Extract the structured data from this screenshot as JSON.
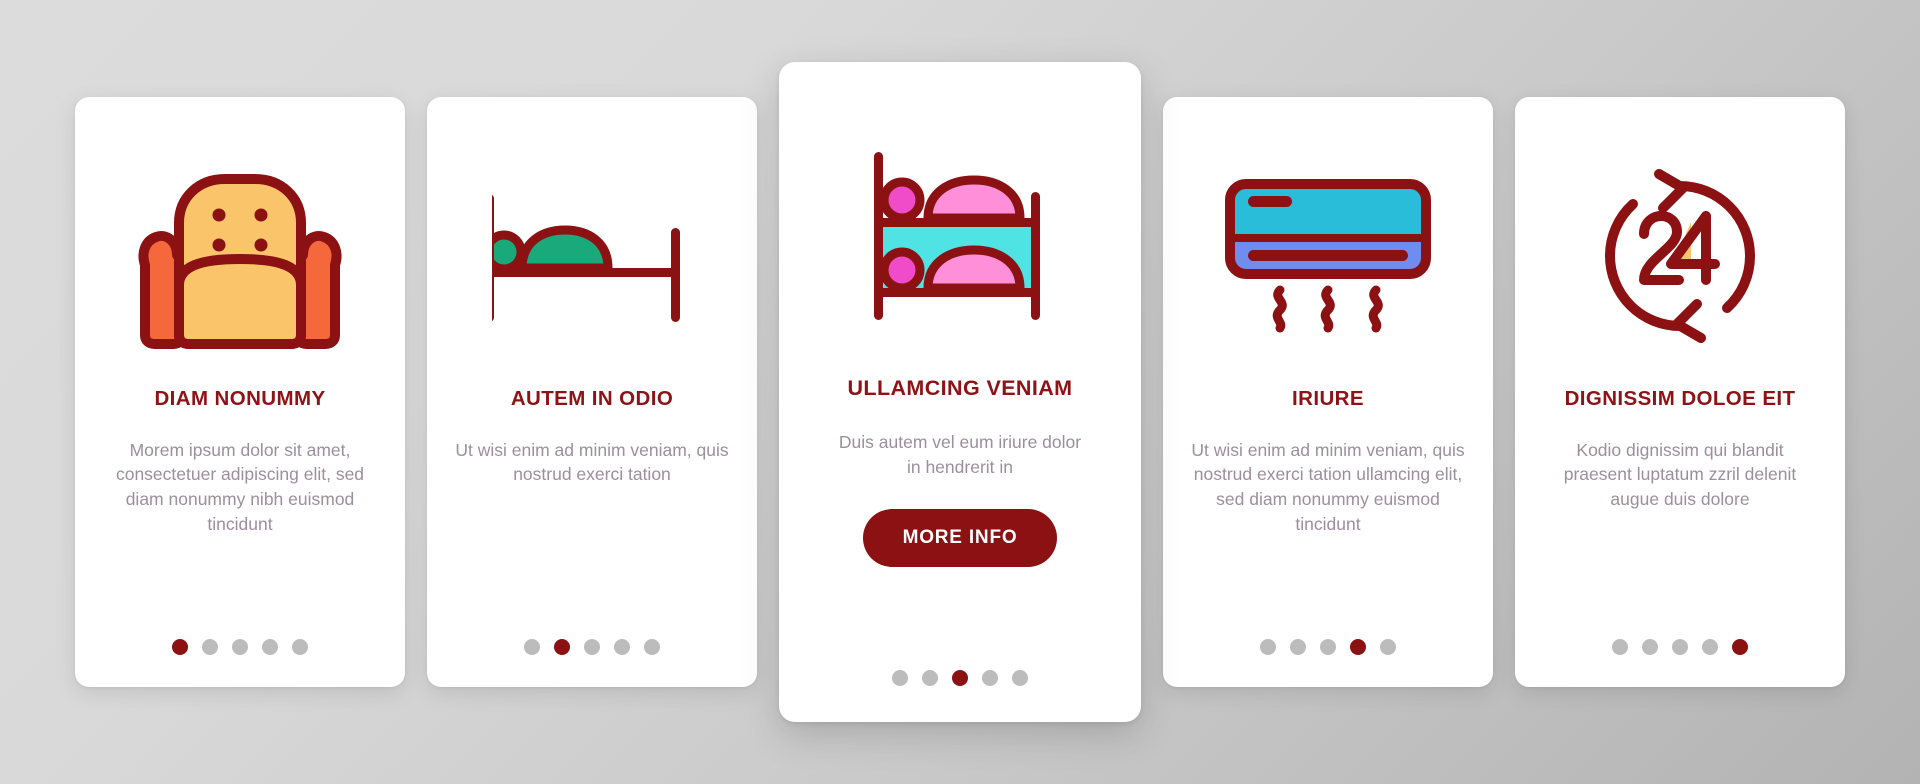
{
  "background": {
    "gradient_from": "#dcdcdc",
    "gradient_to": "#b3b3b3"
  },
  "theme": {
    "accent": "#8B1113",
    "title_color": "#8E1316",
    "body_text_color": "#9c8f9c",
    "dot_inactive": "#bcbcbc",
    "card_background": "#ffffff"
  },
  "cards": [
    {
      "icon_name": "armchair-icon",
      "title": "DIAM NONUMMY",
      "body": "Morem ipsum dolor sit amet, consectetuer adipiscing elit, sed diam nonummy nibh euismod tincidunt",
      "button": null,
      "dots": {
        "count": 5,
        "active_index": 0
      },
      "featured": false
    },
    {
      "icon_name": "single-bed-icon",
      "title": "AUTEM IN ODIO",
      "body": "Ut wisi enim ad minim veniam, quis nostrud exerci tation",
      "button": null,
      "dots": {
        "count": 5,
        "active_index": 1
      },
      "featured": false
    },
    {
      "icon_name": "bunk-bed-icon",
      "title": "ULLAMCING VENIAM",
      "body": "Duis autem vel eum iriure dolor in hendrerit in",
      "button": "MORE INFO",
      "dots": {
        "count": 5,
        "active_index": 2
      },
      "featured": true
    },
    {
      "icon_name": "air-conditioner-icon",
      "title": "IRIURE",
      "body": "Ut wisi enim ad minim veniam, quis nostrud exerci tation ullamcing elit, sed diam nonummy euismod tincidunt",
      "button": null,
      "dots": {
        "count": 5,
        "active_index": 3
      },
      "featured": false
    },
    {
      "icon_name": "24-hours-service-icon",
      "title": "DIGNISSIM DOLOE EIT",
      "body": "Kodio dignissim qui blandit praesent luptatum zzril delenit augue duis dolore",
      "button": null,
      "dots": {
        "count": 5,
        "active_index": 4
      },
      "featured": false
    }
  ],
  "icon_colors": {
    "outline": "#8B1113",
    "armchair_body": "#F9C46A",
    "armchair_arms": "#F4683C",
    "bed_blanket_green": "#19A97B",
    "bunk_blanket_pink": "#FF8FD8",
    "bunk_pillow_magenta": "#F04BC8",
    "bunk_panel_cyan": "#4FE3E3",
    "ac_top_cyan": "#29BDD9",
    "ac_bottom_blue": "#6E8DEE",
    "badge_yellow": "#F9C46A"
  }
}
